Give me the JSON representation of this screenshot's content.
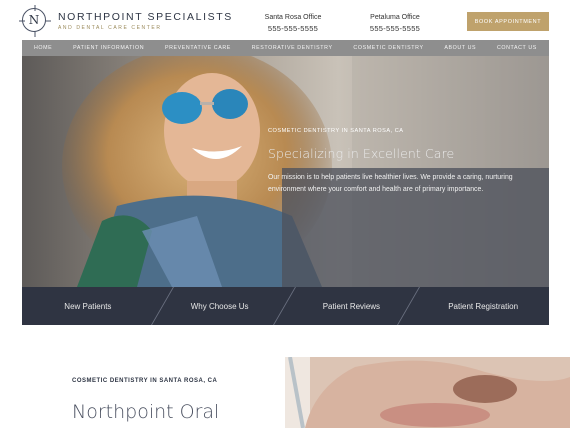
{
  "brand": {
    "logo_letter": "N",
    "name": "NORTHPOINT SPECIALISTS",
    "tagline": "AND DENTAL CARE CENTER"
  },
  "offices": [
    {
      "label": "Santa Rosa Office",
      "phone": "555-555-5555"
    },
    {
      "label": "Petaluma Office",
      "phone": "555-555-5555"
    }
  ],
  "book_button": "BOOK APPOINTMENT",
  "nav": [
    "HOME",
    "PATIENT INFORMATION",
    "PREVENTATIVE CARE",
    "RESTORATIVE DENTISTRY",
    "COSMETIC DENTISTRY",
    "ABOUT US",
    "CONTACT US"
  ],
  "hero": {
    "eyebrow": "COSMETIC DENTISTRY IN SANTA ROSA, CA",
    "title": "Specializing in Excellent Care",
    "body": "Our mission is to help patients live healthier lives. We provide a caring, nurturing environment where your comfort and health are of primary importance."
  },
  "tabs": [
    "New Patients",
    "Why Choose Us",
    "Patient Reviews",
    "Patient Registration"
  ],
  "section": {
    "eyebrow": "COSMETIC DENTISTRY IN SANTA ROSA, CA",
    "title": "Northpoint Oral"
  },
  "colors": {
    "accent_gold": "#bfa26c",
    "nav_gray": "#8e8e8e",
    "tab_bar": "#2f3442",
    "hero_panel": "#4e525c"
  }
}
